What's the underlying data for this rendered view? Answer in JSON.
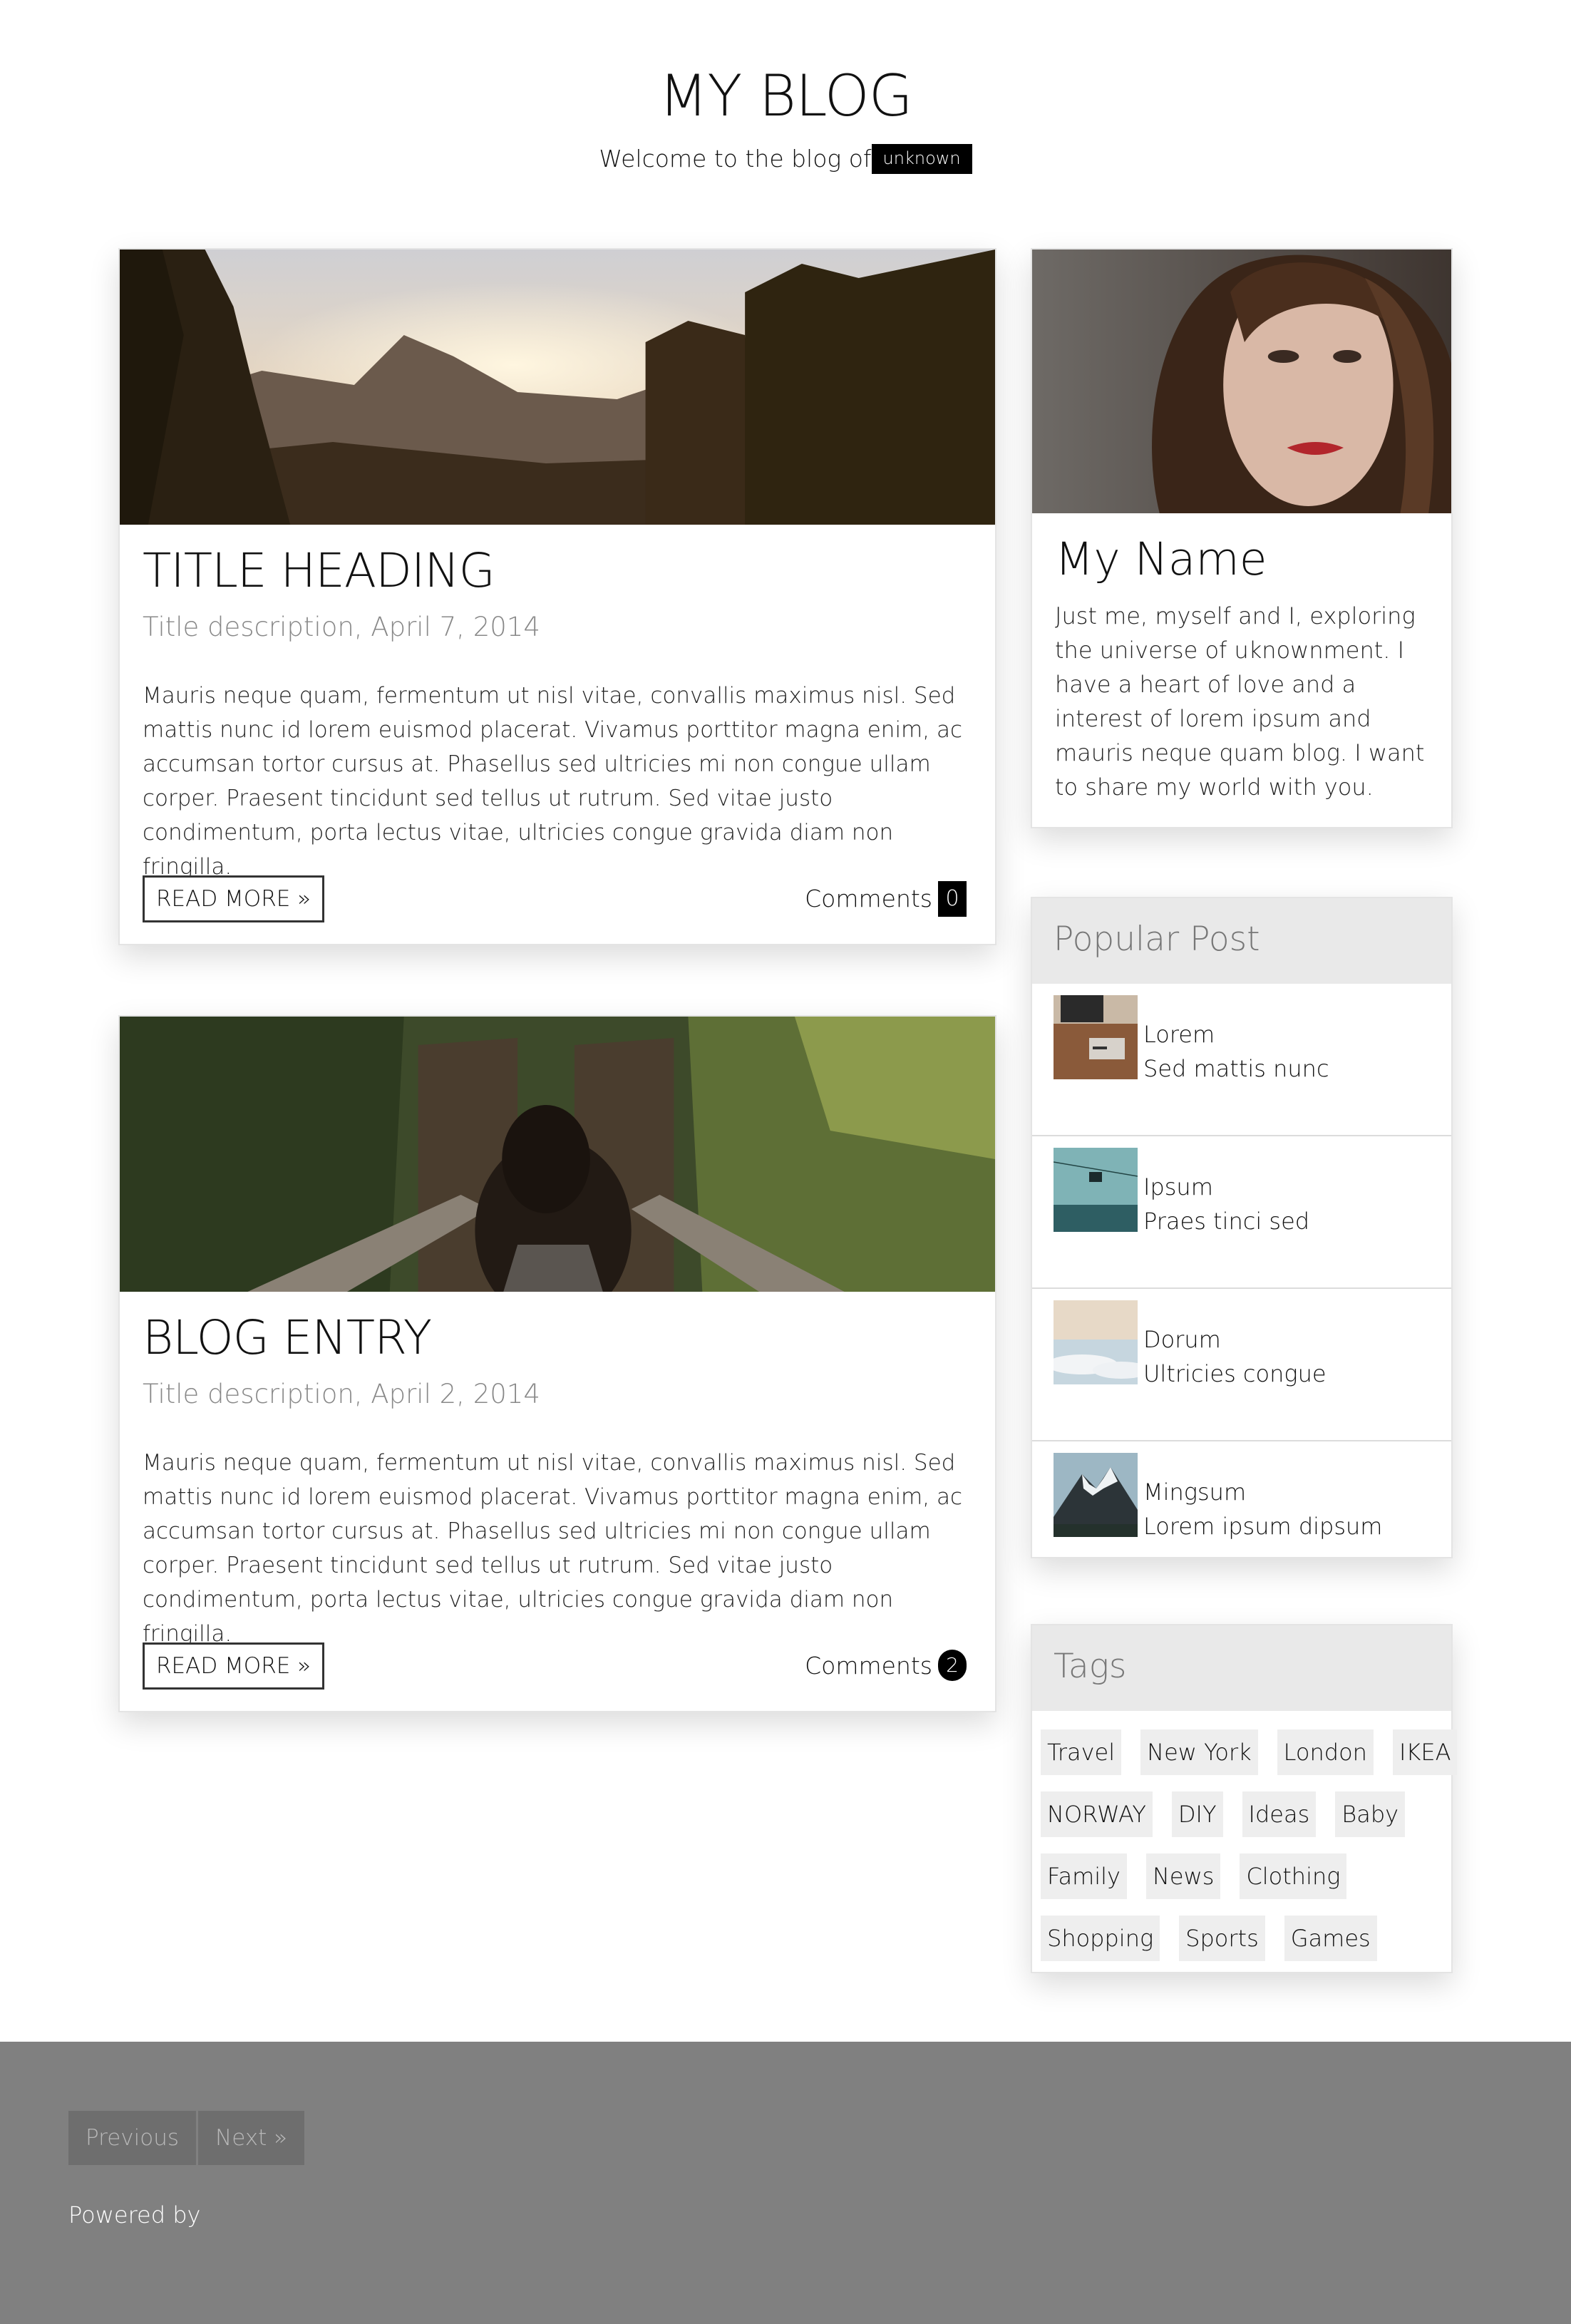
{
  "header": {
    "title": "MY BLOG",
    "subtitle": "Welcome to the blog of",
    "author_tag": "unknown"
  },
  "posts": [
    {
      "title": "TITLE HEADING",
      "description": "Title description, April 7, 2014",
      "body": "Mauris neque quam, fermentum ut nisl vitae, convallis maximus nisl. Sed mattis nunc id lorem euismod placerat. Vivamus porttitor magna enim, ac accumsan tortor cursus at. Phasellus sed ultricies mi non congue ullam corper. Praesent tincidunt sed tellus ut rutrum. Sed vitae justo condimentum, porta lectus vitae, ultricies congue gravida diam non fringilla.",
      "read_more": "READ MORE »",
      "comments_label": "Comments",
      "comments_count": "0",
      "image_icon": "mountain-sunset-photo"
    },
    {
      "title": "BLOG ENTRY",
      "description": "Title description, April 2, 2014",
      "body": "Mauris neque quam, fermentum ut nisl vitae, convallis maximus nisl. Sed mattis nunc id lorem euismod placerat. Vivamus porttitor magna enim, ac accumsan tortor cursus at. Phasellus sed ultricies mi non congue ullam corper. Praesent tincidunt sed tellus ut rutrum. Sed vitae justo condimentum, porta lectus vitae, ultricies congue gravida diam non fringilla.",
      "read_more": "READ MORE »",
      "comments_label": "Comments",
      "comments_count": "2",
      "image_icon": "bridge-woman-photo"
    }
  ],
  "profile": {
    "name": "My Name",
    "bio": "Just me, myself and I, exploring the universe of uknownment. I have a heart of love and a interest of lorem ipsum and mauris neque quam blog. I want to share my world with you.",
    "image_icon": "portrait-photo"
  },
  "popular": {
    "title": "Popular Post",
    "items": [
      {
        "title": "Lorem",
        "subtitle": "Sed mattis nunc",
        "icon": "workspace-thumb"
      },
      {
        "title": "Ipsum",
        "subtitle": "Praes tinci sed",
        "icon": "gondola-thumb"
      },
      {
        "title": "Dorum",
        "subtitle": "Ultricies congue",
        "icon": "clouds-thumb"
      },
      {
        "title": "Mingsum",
        "subtitle": "Lorem ipsum dipsum",
        "icon": "mountain-thumb"
      }
    ]
  },
  "tags": {
    "title": "Tags",
    "rows": [
      [
        "Travel",
        "New York",
        "London",
        "IKEA"
      ],
      [
        "NORWAY",
        "DIY",
        "Ideas",
        "Baby"
      ],
      [
        "Family",
        "News",
        "Clothing"
      ],
      [
        "Shopping",
        "Sports",
        "Games"
      ]
    ]
  },
  "footer": {
    "previous": "Previous",
    "next": "Next »",
    "powered_by": "Powered by",
    "background": "#808080"
  },
  "colors": {
    "accent": "#000000",
    "widget_header": "#e9e9e9",
    "tag_bg": "#eeeeee"
  }
}
